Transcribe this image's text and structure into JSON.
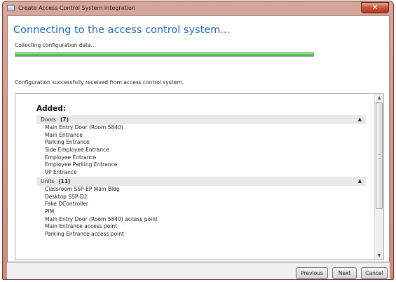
{
  "window": {
    "title": "Create Access Control System Integration",
    "close_glyph": "✕"
  },
  "main": {
    "heading": "Connecting to the access control system...",
    "status_text": "Collecting configuration data...",
    "progress_value": 1.0,
    "success_text": "Configuration successfully received from access control system."
  },
  "list": {
    "added_label": "Added:",
    "groups": [
      {
        "name": "Doors",
        "count": "(7)",
        "collapse_glyph": "▲",
        "items": [
          "Main Entry Door (Room 5840)",
          "Main Entrance",
          "Parking Entrance",
          "Side Employee Entrance",
          "Employee Entrance",
          "Employee Parking Entrance",
          "VP Entrance"
        ]
      },
      {
        "name": "Units",
        "count": "(11)",
        "collapse_glyph": "▲",
        "items": [
          "Classroom SSP-EP Main Bldg",
          "Desktop SSP-D2",
          "Fake DController",
          "PIM",
          "Main Entry Door (Room 5840) access point",
          "Main Entrance access point",
          "Parking Entrance access point"
        ]
      }
    ],
    "scroll_up_glyph": "▲",
    "scroll_down_glyph": "▼"
  },
  "footer": {
    "previous_label": "Previous",
    "next_label": "Next",
    "cancel_label": "Cancel"
  },
  "colors": {
    "heading": "#2769b5",
    "progress_fill": "#3db132",
    "window_frame": "#c98e80",
    "close_button": "#c9523a"
  },
  "icons": {
    "app": "window-app-icon",
    "close": "close-icon",
    "collapse": "chevron-up-icon",
    "scroll_up": "scroll-up-arrow-icon",
    "scroll_down": "scroll-down-arrow-icon"
  }
}
